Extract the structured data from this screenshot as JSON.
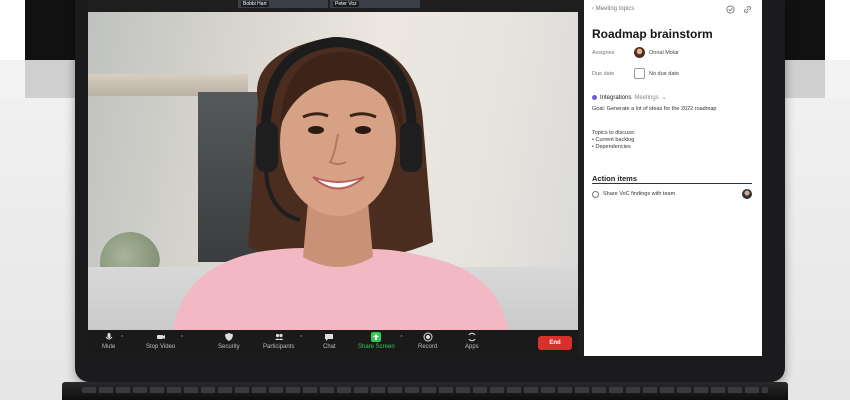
{
  "participants": [
    {
      "name": "Bobbi Hart"
    },
    {
      "name": "Peter Voz"
    }
  ],
  "controls": {
    "mute": "Mute",
    "stop_video": "Stop Video",
    "security": "Security",
    "participants": "Participants",
    "chat": "Chat",
    "share_screen": "Share Screen",
    "record": "Record",
    "apps": "Apps",
    "end": "End"
  },
  "panel": {
    "back_label": "Meeting topics",
    "title": "Roadmap brainstorm",
    "assignee_label": "Assignee",
    "assignee_value": "Onnal Molar",
    "due_label": "Due date",
    "due_value": "No due date",
    "integrations_label": "Integrations",
    "integrations_sub": "Meetings",
    "goal_text": "Goal: Generate a lot of ideas for the 2022 roadmap",
    "topics_text": "Topics to discuss:",
    "topic_items": [
      "Current backlog",
      "Dependencies"
    ],
    "action_items_title": "Action items",
    "action_items": [
      {
        "text": "Share VoC findings with team"
      }
    ]
  },
  "colors": {
    "end_button": "#d9302c",
    "share_screen": "#2ecc52",
    "integrations_dot": "#6b5be2"
  }
}
